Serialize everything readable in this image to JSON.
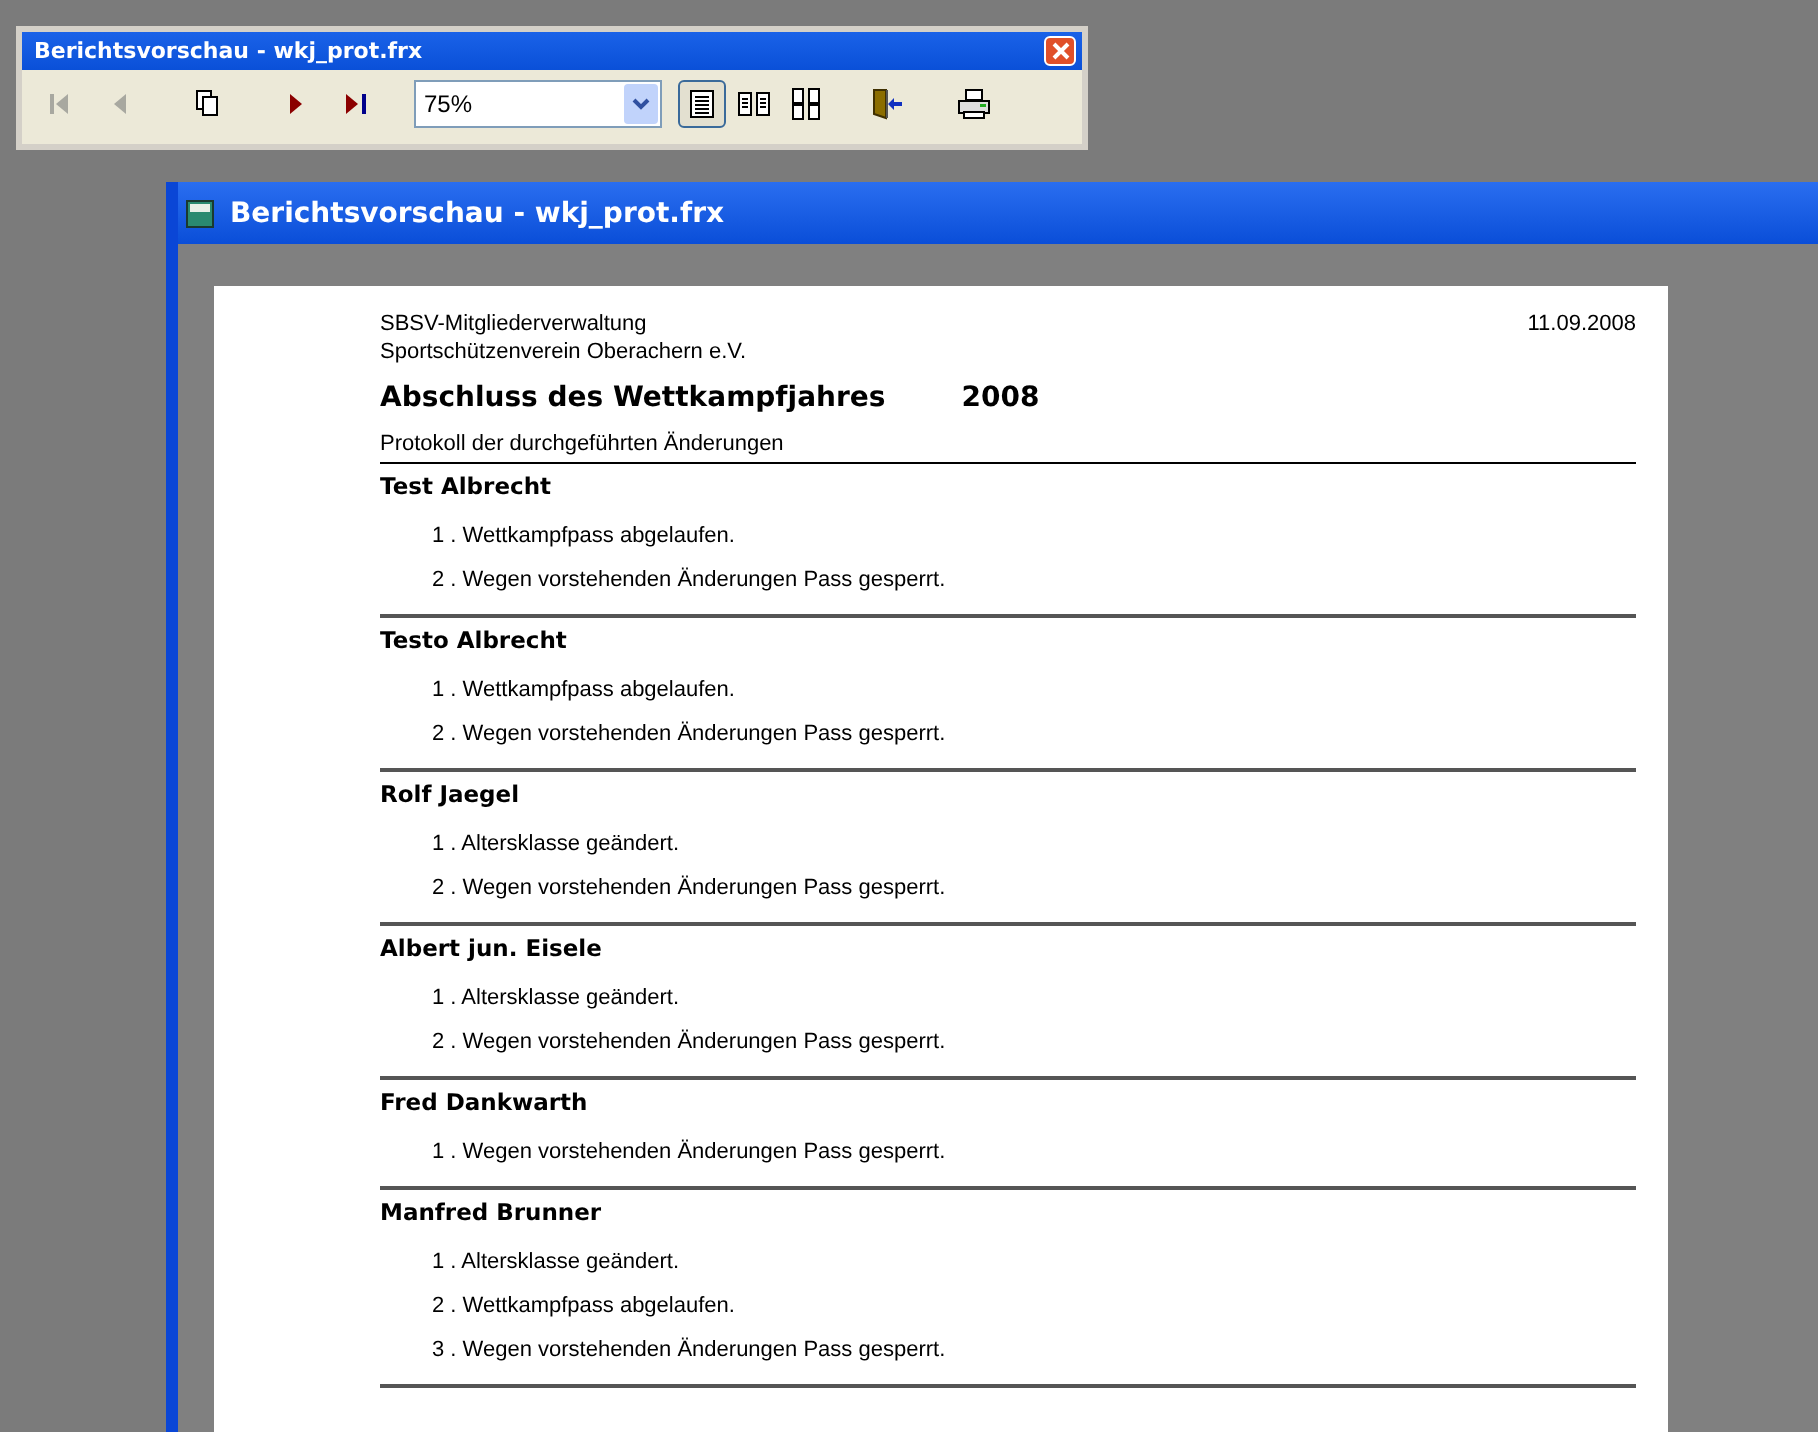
{
  "toolbar_window": {
    "title": "Berichtsvorschau - wkj_prot.frx",
    "buttons": [
      {
        "kind": "first",
        "disabled": true
      },
      {
        "kind": "prev",
        "disabled": true
      },
      {
        "kind": "pages",
        "disabled": false
      },
      {
        "kind": "next",
        "disabled": false
      },
      {
        "kind": "last",
        "disabled": false
      }
    ],
    "zoom": {
      "value": "75%"
    },
    "views": [
      {
        "kind": "one",
        "selected": true
      },
      {
        "kind": "two",
        "selected": false
      },
      {
        "kind": "four",
        "selected": false
      }
    ],
    "actions": [
      {
        "kind": "exit"
      },
      {
        "kind": "print"
      }
    ]
  },
  "preview_window": {
    "title": "Berichtsvorschau - wkj_prot.frx"
  },
  "report": {
    "org": "SBSV-Mitgliederverwaltung",
    "club": "Sportschützenverein Oberachern e.V.",
    "date": "11.09.2008",
    "title": "Abschluss des Wettkampfjahres",
    "year": "2008",
    "subtitle": "Protokoll der durchgeführten Änderungen",
    "members": [
      {
        "name": "Test Albrecht",
        "items": [
          "1 . Wettkampfpass abgelaufen.",
          "2 . Wegen vorstehenden Änderungen Pass gesperrt."
        ]
      },
      {
        "name": "Testo Albrecht",
        "items": [
          "1 . Wettkampfpass abgelaufen.",
          "2 . Wegen vorstehenden Änderungen Pass gesperrt."
        ]
      },
      {
        "name": "Rolf Jaegel",
        "items": [
          "1 . Altersklasse geändert.",
          "2 . Wegen vorstehenden Änderungen Pass gesperrt."
        ]
      },
      {
        "name": "Albert jun. Eisele",
        "items": [
          "1 . Altersklasse geändert.",
          "2 . Wegen vorstehenden Änderungen Pass gesperrt."
        ]
      },
      {
        "name": "Fred Dankwarth",
        "items": [
          "1 . Wegen vorstehenden Änderungen Pass gesperrt."
        ]
      },
      {
        "name": "Manfred Brunner",
        "items": [
          "1 . Altersklasse geändert.",
          "2 . Wettkampfpass abgelaufen.",
          "3 . Wegen vorstehenden Änderungen Pass gesperrt."
        ]
      }
    ]
  }
}
